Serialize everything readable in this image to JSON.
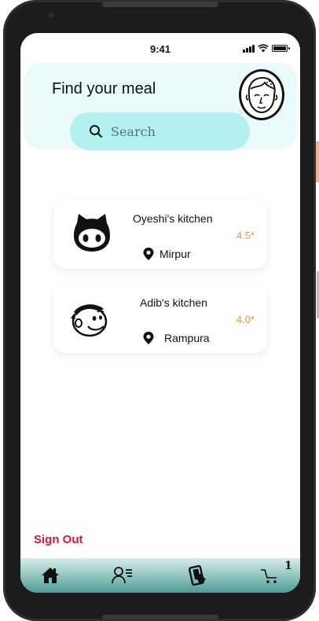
{
  "status_bar": {
    "time": "9:41"
  },
  "header": {
    "title": "Find your meal",
    "search": {
      "placeholder": "Search",
      "value": ""
    }
  },
  "kitchens": [
    {
      "name": "Oyeshi's kitchen",
      "rating": "4.5*",
      "location": "Mirpur",
      "logo_icon": "octocat-icon"
    },
    {
      "name": "Adib's kitchen",
      "rating": "4.0*",
      "location": "Rampura",
      "logo_icon": "mailchimp-icon"
    }
  ],
  "sign_out_label": "Sign Out",
  "bottom_nav": {
    "items": [
      "home-icon",
      "user-list-icon",
      "phone-order-icon",
      "cart-icon"
    ],
    "cart_count": "1"
  },
  "colors": {
    "header_bg": "#e8fbfa",
    "search_bg": "#b4f0ef",
    "rating": "#f0923a",
    "sign_out": "#e8112d",
    "nav_gradient_end": "#4f9c97"
  }
}
